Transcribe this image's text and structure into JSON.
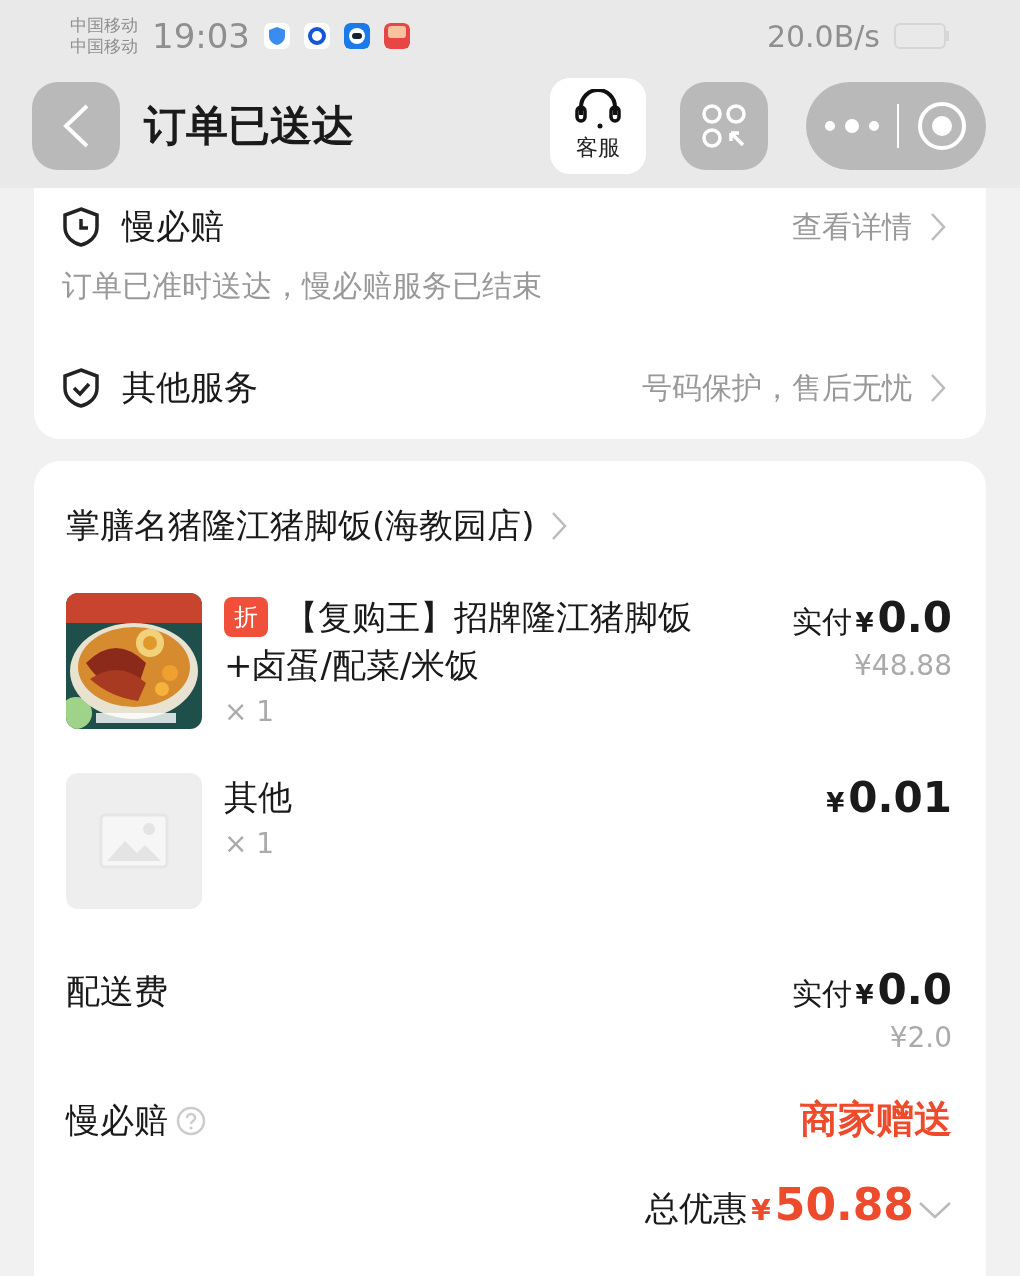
{
  "status_bar": {
    "carriers": [
      "中国移动",
      "中国移动"
    ],
    "time": "19:03",
    "speed": "20.0B/s"
  },
  "header": {
    "title": "订单已送达",
    "service_label": "客服"
  },
  "services": [
    {
      "kind": "clock",
      "title": "慢必赔",
      "link": "查看详情",
      "note": "订单已准时送达，慢必赔服务已结束"
    },
    {
      "kind": "shield",
      "title": "其他服务",
      "link": "号码保护，售后无忧"
    }
  ],
  "order": {
    "shop": "掌膳名猪隆江猪脚饭(海教园店)",
    "items": [
      {
        "kind": "picture",
        "tag": "折",
        "name": "【复购王】招牌隆江猪脚饭+卤蛋/配菜/米饭",
        "quantity": "× 1",
        "price_label": "实付",
        "currency": "¥",
        "price": "0.0",
        "original_price": "¥48.88"
      },
      {
        "kind": "placeholder",
        "name": "其他",
        "quantity": "× 1",
        "currency": "¥",
        "price": "0.01"
      }
    ],
    "delivery": {
      "label": "配送费",
      "price_label": "实付",
      "currency": "¥",
      "price": "0.0",
      "original_price": "¥2.0"
    },
    "guarantee": {
      "label": "慢必赔",
      "value": "商家赠送"
    },
    "total": {
      "label": "总优惠",
      "currency": "¥",
      "amount": "50.88"
    }
  }
}
